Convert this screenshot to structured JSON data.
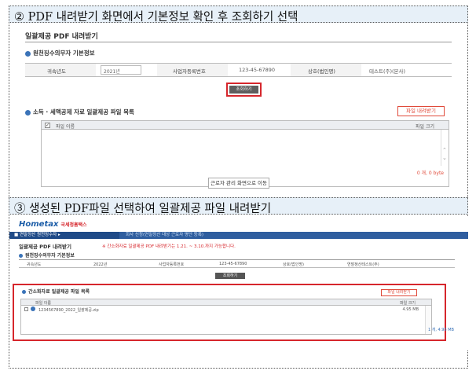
{
  "captions": {
    "step2": "② PDF 내려받기 화면에서 기본정보 확인 후 조회하기 선택",
    "step3": "③ 생성된 PDF파일 선택하여 일괄제공 파일 내려받기"
  },
  "shot1": {
    "title": "일괄제공 PDF 내려받기",
    "section1": "원천징수의무자 기본정보",
    "info": {
      "year_label": "귀속년도",
      "year_value": "2021년",
      "bizno_label": "사업자등록번호",
      "bizno_value": "123-45-67890",
      "name_label": "상호(법인명)",
      "name_value": "테스트(주)(본사)"
    },
    "query_button": "조회하기",
    "section2": "소득 · 세액공제 자료 일괄제공 파일 목록",
    "download_button": "파일 내려받기",
    "col_name": "파일 이름",
    "col_size": "파일 크기",
    "checkbox": "✓",
    "total": "0 개, 0 byte",
    "nav_button": "근로자 관리 화면으로 이동"
  },
  "shot2": {
    "logo": "Hometax",
    "logo_sub": "국세청홈택스",
    "nav_menu": "연말정산 원천징수자",
    "nav_path": "회사 신청(연말정산 대상 근로자 명단 등록)",
    "title": "일괄제공 PDF 내려받기",
    "notice": "※ 간소화자료 일괄제공 PDF 내려받기는 1.21. ~ 3.10.까지 가능합니다.",
    "section1": "원천징수의무자 기본정보",
    "info": {
      "year_label": "귀속년도",
      "year_value": "2022년",
      "bizno_label": "사업자등록번호",
      "bizno_value": "123-45-67890",
      "name_label": "상호(법인명)",
      "name_value": "연말정산테스트(주)"
    },
    "query_button": "조회하기",
    "section2": "간소화자료 일괄제공 파일 목록",
    "download_button": "파일 내려받기",
    "col_name": "파일 이름",
    "col_size": "파일 크기",
    "file_name": "1234567890_2022_일괄제공.zip",
    "file_size": "4.95 MB",
    "total": "1 개, 4.95 MB"
  }
}
